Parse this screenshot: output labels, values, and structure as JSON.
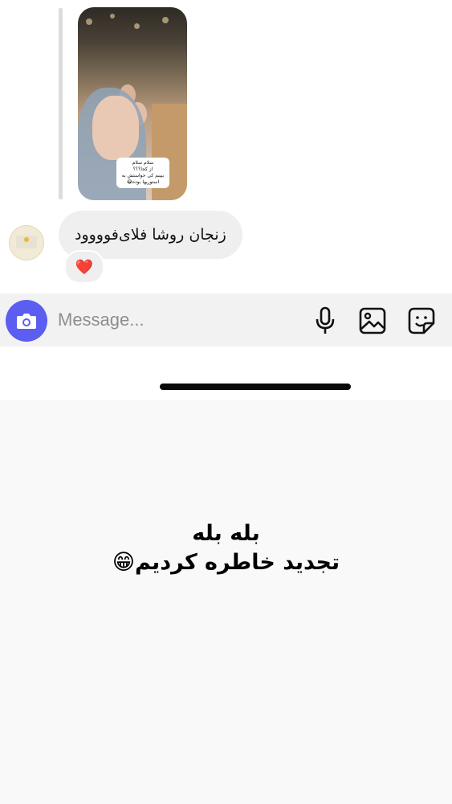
{
  "thread": {
    "story_caption_lines": [
      "سلام سلام",
      "از کجا؟؟؟",
      "ببینم کی حواستش به",
      "استوریها بوده😂"
    ],
    "message_text": "زنجان روشا فلای‌فوووود",
    "reaction": "❤️"
  },
  "composer": {
    "placeholder": "Message...",
    "icons": [
      "camera-icon",
      "microphone-icon",
      "gallery-icon",
      "sticker-icon"
    ],
    "accent": "#5b5ef0"
  },
  "overlay": {
    "line1": "بله بله",
    "line2": "تجدید خاطره کردیم😁"
  }
}
